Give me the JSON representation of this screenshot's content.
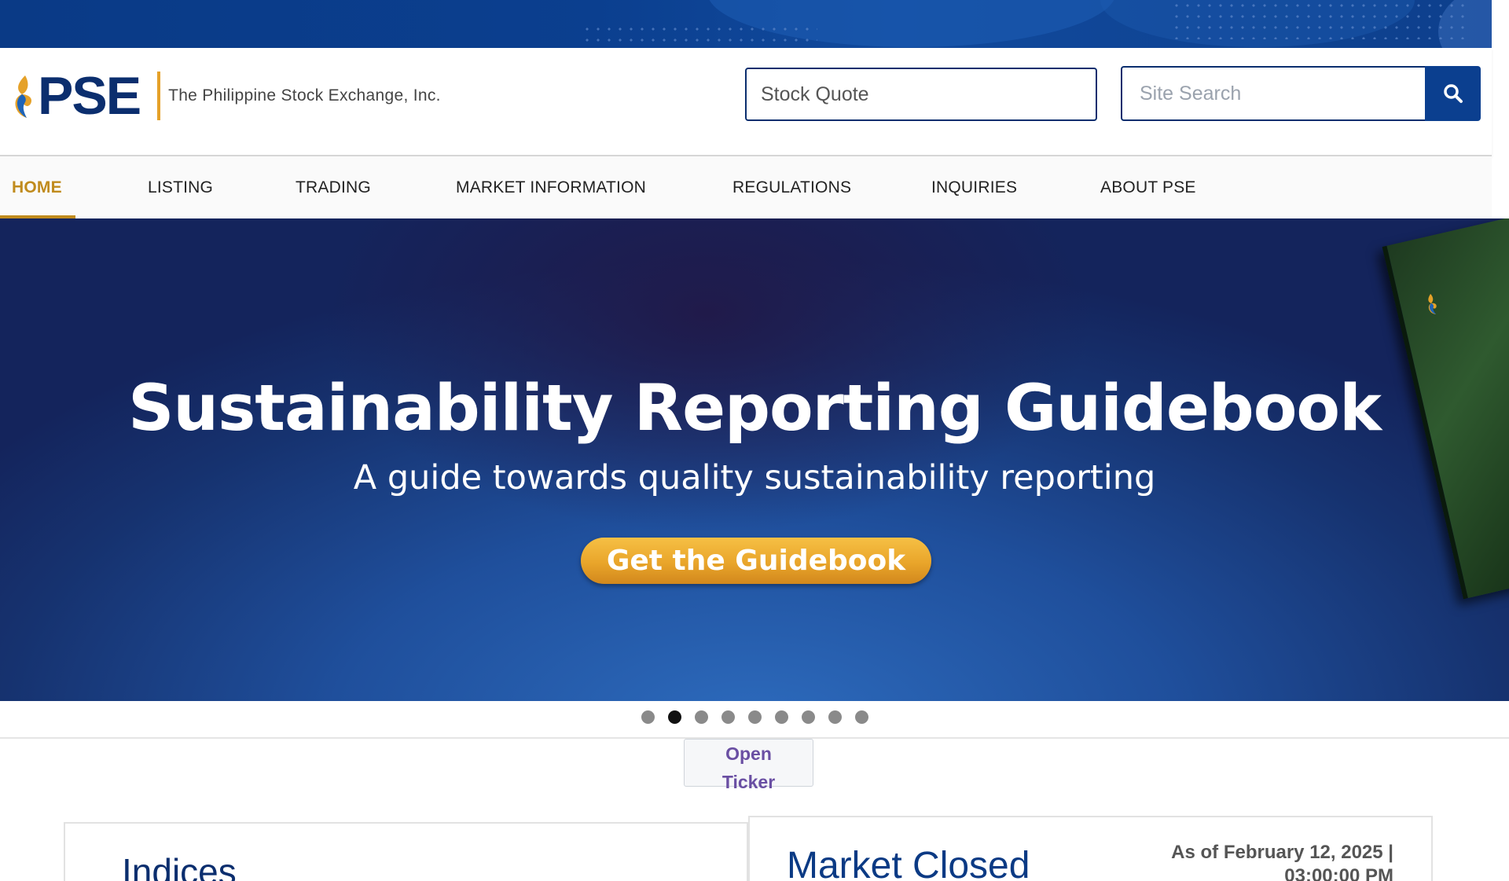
{
  "header": {
    "logo_text": "PSE",
    "tagline": "The Philippine Stock Exchange, Inc.",
    "stock_quote_value": "Stock Quote",
    "site_search_placeholder": "Site Search"
  },
  "nav": {
    "items": [
      {
        "label": "HOME",
        "active": true
      },
      {
        "label": "LISTING"
      },
      {
        "label": "TRADING"
      },
      {
        "label": "MARKET INFORMATION"
      },
      {
        "label": "REGULATIONS"
      },
      {
        "label": "INQUIRIES"
      },
      {
        "label": "ABOUT PSE"
      }
    ]
  },
  "hero": {
    "title": "Sustainability Reporting Guidebook",
    "subtitle": "A guide towards quality sustainability reporting",
    "cta_label": "Get the Guidebook"
  },
  "carousel": {
    "slide_count": 9,
    "active_index": 1
  },
  "ticker": {
    "button_line1": "Open",
    "button_line2": "Ticker"
  },
  "indices": {
    "title": "Indices"
  },
  "market": {
    "status": "Market Closed",
    "as_of_line1": "As of February 12, 2025 |",
    "as_of_line2": "03:00:00 PM"
  },
  "colors": {
    "brand_navy": "#0b2e6e",
    "brand_gold": "#c08b1d",
    "cta_orange": "#e9a52a"
  },
  "icons": {
    "search": "magnifier-icon",
    "logo_mark": "pse-flame-icon"
  }
}
